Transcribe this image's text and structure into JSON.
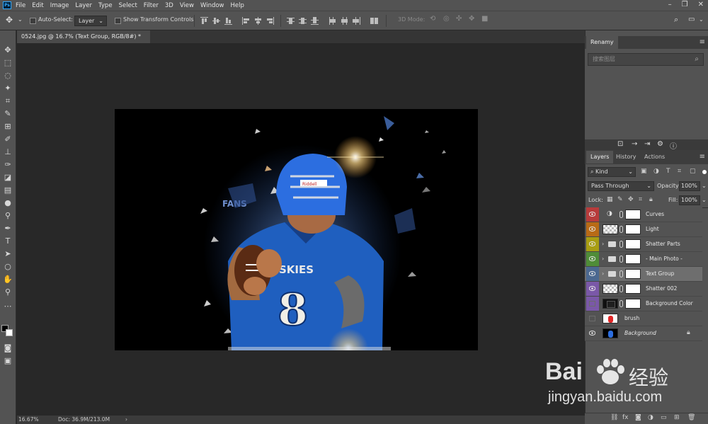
{
  "menu": [
    "File",
    "Edit",
    "Image",
    "Layer",
    "Type",
    "Select",
    "Filter",
    "3D",
    "View",
    "Window",
    "Help"
  ],
  "options": {
    "auto_select_label": "Auto-Select:",
    "auto_select_value": "Layer",
    "show_transform_label": "Show Transform Controls",
    "mode_3d_label": "3D Mode:"
  },
  "document": {
    "tab_title": "0524.jpg @ 16.7% (Text Group, RGB/8#) *",
    "zoom": "16.67%",
    "doc_size": "Doc: 36.9M/213.0M"
  },
  "renamy": {
    "title": "Renamy",
    "search_placeholder": "搜索图层"
  },
  "layers_panel": {
    "tabs": [
      "Layers",
      "History",
      "Actions"
    ],
    "kind_label": "Kind",
    "blend_mode": "Pass Through",
    "opacity_label": "Opacity:",
    "opacity_value": "100%",
    "lock_label": "Lock:",
    "fill_label": "Fill:",
    "fill_value": "100%",
    "layers": [
      {
        "name": "Curves",
        "color": "#b83b3b",
        "visible": true,
        "type": "adjustment"
      },
      {
        "name": "Light",
        "color": "#b86a16",
        "visible": true,
        "type": "pixel"
      },
      {
        "name": "Shatter Parts",
        "color": "#a89d12",
        "visible": true,
        "type": "group"
      },
      {
        "name": "- Main Photo -",
        "color": "#4f8c38",
        "visible": true,
        "type": "group"
      },
      {
        "name": "Text Group",
        "color": "#4b6890",
        "visible": true,
        "type": "group",
        "selected": true
      },
      {
        "name": "Shatter 002",
        "color": "#7a58a8",
        "visible": true,
        "type": "pixel"
      },
      {
        "name": "Background Color",
        "color": "#7a58a8",
        "visible": false,
        "type": "fill"
      },
      {
        "name": "brush",
        "color": "",
        "visible": false,
        "type": "image"
      },
      {
        "name": "Background",
        "color": "",
        "visible": true,
        "type": "background",
        "locked": true
      }
    ]
  },
  "photo": {
    "helmet_text": "Riddell",
    "jersey_text": "SKIES",
    "jersey_number": "8",
    "sleeve_text": "FANS"
  },
  "watermark": {
    "brand": "Bai",
    "brand_suffix": "经验",
    "url": "jingyan.baidu.com"
  },
  "colors": {
    "panel_bg": "#535353",
    "canvas_bg": "#282828",
    "jersey_blue": "#1f5fbf"
  }
}
